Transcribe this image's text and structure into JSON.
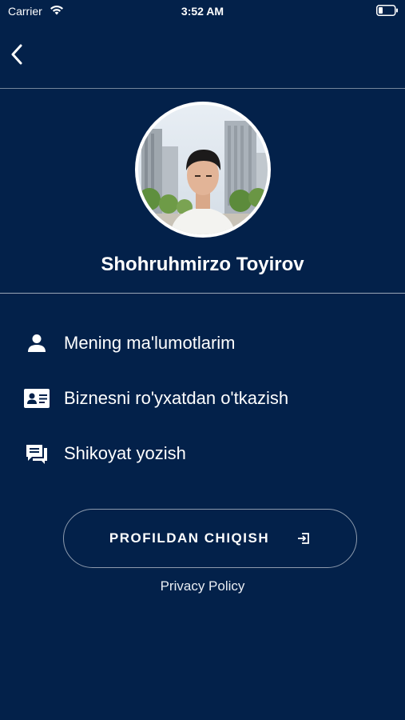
{
  "status_bar": {
    "carrier": "Carrier",
    "time": "3:52 AM",
    "wifi_icon": "wifi-icon",
    "battery_icon": "battery-icon"
  },
  "nav": {
    "back_icon": "chevron-left-icon"
  },
  "profile": {
    "name": "Shohruhmirzo Toyirov",
    "avatar": "profile-photo"
  },
  "menu": {
    "items": [
      {
        "label": "Mening ma'lumotlarim",
        "icon": "person-icon"
      },
      {
        "label": "Biznesni ro'yxatdan o'tkazish",
        "icon": "id-card-icon"
      },
      {
        "label": "Shikoyat yozish",
        "icon": "chat-feedback-icon"
      }
    ]
  },
  "logout": {
    "label": "PROFILDAN CHIQISH",
    "icon": "logout-icon"
  },
  "privacy_policy": "Privacy Policy",
  "colors": {
    "background": "#03214a",
    "text": "#ffffff"
  }
}
